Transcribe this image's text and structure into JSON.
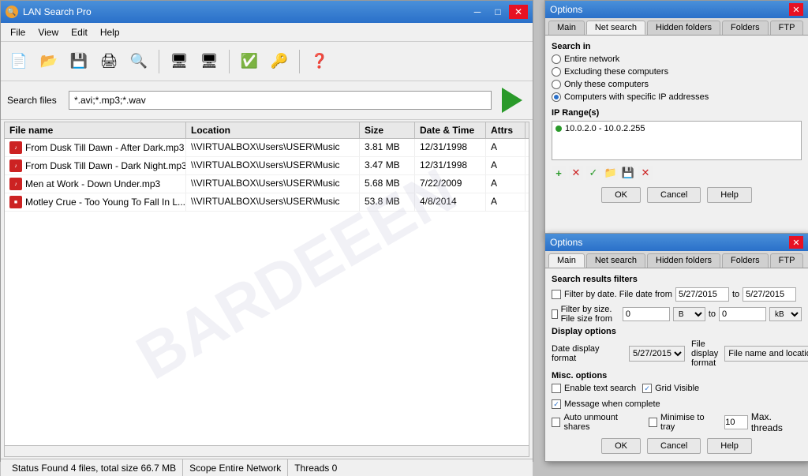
{
  "mainWindow": {
    "title": "LAN Search Pro",
    "icon": "🔍"
  },
  "menuBar": {
    "items": [
      "File",
      "View",
      "Edit",
      "Help"
    ]
  },
  "toolbar": {
    "buttons": [
      {
        "icon": "📄",
        "name": "new"
      },
      {
        "icon": "📂",
        "name": "open"
      },
      {
        "icon": "💾",
        "name": "save"
      },
      {
        "icon": "💾",
        "name": "save-as"
      },
      {
        "icon": "🔍",
        "name": "search"
      },
      {
        "icon": "🖥",
        "name": "network"
      },
      {
        "icon": "🖥",
        "name": "network2"
      },
      {
        "icon": "✅",
        "name": "check"
      },
      {
        "icon": "🔑",
        "name": "key"
      },
      {
        "icon": "❓",
        "name": "help"
      }
    ]
  },
  "searchBar": {
    "label": "Search files",
    "value": "*.avi;*.mp3;*.wav",
    "placeholder": "*.avi;*.mp3;*.wav"
  },
  "fileList": {
    "headers": [
      "File name",
      "Location",
      "Size",
      "Date & Time",
      "Attrs"
    ],
    "rows": [
      {
        "name": "From Dusk Till Dawn - After Dark.mp3",
        "location": "\\\\VIRTUALBOX\\Users\\USER\\Music",
        "size": "3.81 MB",
        "datetime": "12/31/1998",
        "attrs": "A"
      },
      {
        "name": "From Dusk Till Dawn - Dark Night.mp3",
        "location": "\\\\VIRTUALBOX\\Users\\USER\\Music",
        "size": "3.47 MB",
        "datetime": "12/31/1998",
        "attrs": "A"
      },
      {
        "name": "Men at Work - Down Under.mp3",
        "location": "\\\\VIRTUALBOX\\Users\\USER\\Music",
        "size": "5.68 MB",
        "datetime": "7/22/2009",
        "attrs": "A"
      },
      {
        "name": "Motley Crue - Too Young To Fall In L...",
        "location": "\\\\VIRTUALBOX\\Users\\USER\\Music",
        "size": "53.8 MB",
        "datetime": "4/8/2014",
        "attrs": "A"
      }
    ]
  },
  "statusBar": {
    "status_label": "Status",
    "status_value": "Found 4 files, total size 66.7 MB",
    "scope_label": "Scope",
    "scope_value": "Entire Network",
    "threads_label": "Threads",
    "threads_value": "0"
  },
  "optionsWindow1": {
    "title": "Options",
    "tabs": [
      "Main",
      "Net search",
      "Hidden folders",
      "Folders",
      "FTP"
    ],
    "activeTab": "Net search",
    "searchInLabel": "Search in",
    "radioOptions": [
      {
        "label": "Entire network",
        "selected": false
      },
      {
        "label": "Excluding these computers",
        "selected": false
      },
      {
        "label": "Only these computers",
        "selected": false
      },
      {
        "label": "Computers with specific IP addresses",
        "selected": true
      }
    ],
    "ipRangeLabel": "IP Range(s)",
    "ipRanges": [
      "10.0.2.0 - 10.0.2.255"
    ],
    "iconBar": [
      "+",
      "✕",
      "✓",
      "📁",
      "💾",
      "✕"
    ],
    "buttons": [
      "OK",
      "Cancel",
      "Help"
    ]
  },
  "optionsWindow2": {
    "title": "Options",
    "tabs": [
      "Main",
      "Net search",
      "Hidden folders",
      "Folders",
      "FTP"
    ],
    "activeTab": "Main",
    "searchResultsFiltersLabel": "Search results filters",
    "filterByDate": {
      "label": "Filter by date. File date from",
      "checked": false,
      "from": "5/27/2015",
      "to": "5/27/2015"
    },
    "filterBySize": {
      "label": "Filter by size. File size from",
      "checked": false,
      "from": "0",
      "fromUnit": "B",
      "to": "0",
      "toUnit": "kB"
    },
    "displayOptionsLabel": "Display options",
    "dateDisplayLabel": "Date display format",
    "dateDisplayValue": "5/27/2015",
    "fileDisplayLabel": "File display format",
    "fileDisplayValue": "File name and location separately",
    "miscOptionsLabel": "Misc. options",
    "checkboxes": [
      {
        "label": "Enable text search",
        "checked": false
      },
      {
        "label": "Grid Visible",
        "checked": true
      },
      {
        "label": "Auto unmount shares",
        "checked": false
      },
      {
        "label": "Minimise to tray",
        "checked": false
      },
      {
        "label": "Message when complete",
        "checked": true
      }
    ],
    "maxThreadsLabel": "Max. threads",
    "maxThreadsValue": "10",
    "buttons": [
      "OK",
      "Cancel",
      "Help"
    ]
  },
  "watermark": "BARDEEEN"
}
